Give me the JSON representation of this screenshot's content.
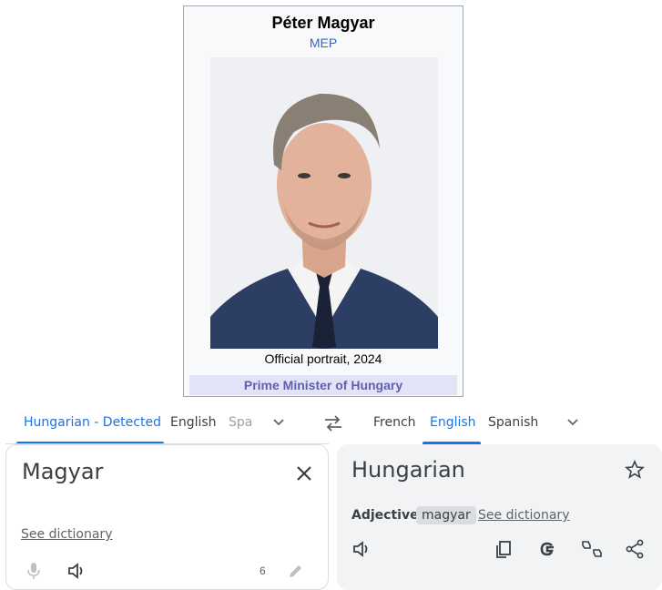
{
  "infobox": {
    "name": "Péter Magyar",
    "subtitle": "MEP",
    "caption": "Official portrait, 2024",
    "office": "Prime Minister of Hungary"
  },
  "language_bar": {
    "source_tabs": [
      "Hungarian - Detected",
      "English",
      "Spa"
    ],
    "target_tabs": [
      "French",
      "English",
      "Spanish"
    ],
    "active_source": "Hungarian - Detected",
    "active_target": "English"
  },
  "source_panel": {
    "text": "Magyar",
    "see_dictionary": "See dictionary",
    "char_count": "6"
  },
  "target_panel": {
    "text": "Hungarian",
    "part_of_speech": "Adjective",
    "word_chip": "magyar",
    "see_dictionary": "See dictionary"
  },
  "icons": {
    "source_more": "chevron-down-icon",
    "swap": "swap-languages-icon",
    "target_more": "chevron-down-icon",
    "clear": "close-icon",
    "mic": "microphone-icon",
    "listen_source": "speaker-icon",
    "edit": "pencil-icon",
    "save": "star-icon",
    "listen_target": "speaker-icon",
    "copy": "copy-icon",
    "google": "google-g-icon",
    "feedback": "thumbs-up-down-icon",
    "share": "share-icon"
  },
  "colors": {
    "accent": "#1a73e8",
    "infobox_bg": "#f8f9fa",
    "office_bar": "#e3e3f7",
    "target_bg": "#f1f3f4",
    "link": "#3366cc"
  }
}
